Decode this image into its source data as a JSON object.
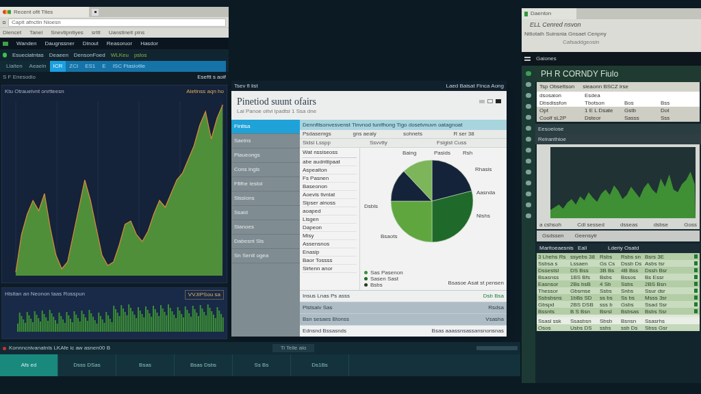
{
  "left_window": {
    "browser_tab": "Recent ofit Tites",
    "address": "Capit afnctin Nioesn",
    "bookmarks": [
      "Diencet",
      "Tanei",
      "Snevtipntiyes",
      "srtlt",
      "Uanstineit pins"
    ],
    "menu": [
      "Wanden",
      "Daugnssner",
      "Dinout",
      "Reasoruor",
      "Hasdor"
    ],
    "toolbar": [
      "Esueciatntas",
      "Deaeen",
      "DensonFoed",
      "WLKeu",
      "pslos"
    ],
    "tabs": [
      {
        "label": "Llaiten",
        "selected": false
      },
      {
        "label": "Aeaein",
        "selected": false
      },
      {
        "label": "ICR",
        "selected": true
      },
      {
        "label": "ZCI",
        "selected": false
      },
      {
        "label": "ES1",
        "selected": false
      },
      {
        "label": "E",
        "selected": false
      },
      {
        "label": "ISC Ftasiotiie",
        "selected": false
      }
    ],
    "section_label": "S F Enesodio",
    "side_note": "Eseftt s aoif",
    "price_panel": {
      "title": "Ktu Otraueivnt onrtteesn",
      "legend": "Aletinss aqn ho"
    },
    "volume_panel": {
      "title": "Hisitan an Neonon taas Rosspun",
      "badge": "VVJIPSou sa"
    }
  },
  "center_window": {
    "top_left": "Tsev fl iist",
    "top_right": "Laed Baisat Finca Aong",
    "title": "Pinetiod suunt ofairs",
    "subtitle": "Lai Panoe oitvi  ipadtsi 1 Ssa dne",
    "sidebar": [
      {
        "label": "Fintisa",
        "selected": true
      },
      {
        "label": "Saeins",
        "selected": false
      },
      {
        "label": "Piaueongs",
        "selected": false
      },
      {
        "label": "Cons ingis",
        "selected": false
      },
      {
        "label": "Ffifhe Iestol",
        "selected": false
      },
      {
        "label": "Sissions",
        "selected": false
      },
      {
        "label": "Ssaid",
        "selected": false
      },
      {
        "label": "Sianoes",
        "selected": false
      },
      {
        "label": "Dabesnt Sls",
        "selected": false
      },
      {
        "label": "Sn Senit ogea",
        "selected": false
      }
    ],
    "banner": "Dennfitsonvesvenst Tinvnod tunifhong Tigo dosetvnuvn oatagnoat",
    "header": [
      "Psdasemgs",
      "gns aealy",
      "sohnets",
      "R ser 38"
    ],
    "subheader": [
      "Sidsi Lsspp",
      "Ssvvtty",
      "Fsigist Cuss"
    ],
    "list_title": "Wat nssiseoss",
    "list": [
      "abe audntiipaat",
      "Aspeaiton",
      "Fs Pasnen",
      "Baseonon",
      "Aoevis tivnlat",
      "Sipser ainoss",
      "aoaped",
      "Lisgen",
      "Dapeon",
      "Misy",
      "Assensnos",
      "Enasip",
      "Baor Tossss",
      "Sirtenn anor"
    ],
    "pie_labels": [
      "Baing",
      "Pasids",
      "Rsh",
      "Rhasis",
      "Aasnda",
      "Nishs",
      "Dsbls",
      "Bsaots"
    ],
    "pie_legend": [
      "Sas Pasenon",
      "Sasen Sast",
      "Bsbs"
    ],
    "pie_footer": "Bsasoe Asat st pensen",
    "footer": [
      {
        "label": "Insus Lnas  Ps asss",
        "value": "Dsb Bsa"
      },
      {
        "label": "Pistsalv Sas",
        "value": "Rsdsa"
      },
      {
        "label": "Bsn sesaes Btonss",
        "value": "Vsasha"
      },
      {
        "label": "Ednsnd Bssasnds",
        "value": "Bsas aaassnsassansnonsnas"
      }
    ]
  },
  "right_window": {
    "browser_tab": "Daenton",
    "address": "ELL Cenred nsvon",
    "links": "Nitiotaih Suinsnia Gnsaet Cenpny",
    "url_hint": "Cafsaddgeosin",
    "toolbar": "Gaiones",
    "title": "PH R CORNDY Fiulo",
    "summary_label": "Tsp Obsettson",
    "summary_value": "sieaonn BSCZ irse",
    "summary_rows": [
      [
        "dsosaion",
        "Esdea",
        "",
        ""
      ],
      [
        "Dbsdissfon",
        "Tbotson",
        "Bos",
        "Bss"
      ],
      [
        "Opt",
        "1 E L Dsate",
        "Gstb",
        "Dot"
      ],
      [
        "Coolf sL2P",
        "Dsteor",
        "Sasss",
        "Sss"
      ]
    ],
    "section_1": "Eesoeiose",
    "section_2": "Reiranthioe",
    "axis_labels": [
      "a cshsoh",
      "Cdl sessed",
      "dsseas",
      "dsbse",
      "Goss"
    ],
    "filter_label": "Gsdssen",
    "filter_value": "Geensytr",
    "table_columns": [
      "Maritoeaesnis",
      "Eall",
      "Lderiy Osatd"
    ],
    "table_rows": [
      [
        "3 Lhehs Rs",
        "ssyebs 38",
        "Rsbs",
        "Rsbs sn",
        "Bsrs 3E"
      ],
      [
        "Ssbsa s",
        "Lssaen",
        "Gs Cs",
        "Dssb Ds",
        "Asbs tsr"
      ],
      [
        "Dssestsl",
        "DS Bss",
        "3B Bs",
        "4B Bss",
        "Dssh Bsr"
      ],
      [
        "Bsasnss",
        "1BS Bfs",
        "Bsbs",
        "Bssos",
        "Bs Essr"
      ],
      [
        "Easnsor",
        "2Bs bsB",
        "4 Sb",
        "Ssbs",
        "2BS Bsn"
      ],
      [
        "Thessor",
        "Gbsmse",
        "Ssbs",
        "Snbs",
        "Ssur dsr"
      ],
      [
        "Ssbsbsns",
        "1bBs SD",
        "ss bs",
        "Ss bs",
        "Msss 3sr"
      ],
      [
        "Gbspd",
        "2BS DSB",
        "sss b",
        "Gsbs",
        "Ssad Ssr"
      ],
      [
        "Bssnts",
        "B S Bsn",
        "Bsrsl",
        "Bsbsas",
        "Bsbs Ssr"
      ]
    ],
    "total_rows": [
      [
        "Ssasl ssk",
        "Ssasbsn",
        "Sbsb",
        "Bsnsn",
        "Ssasrhs"
      ],
      [
        "Osos",
        "Usbs DS",
        "ssbs",
        "ssb Ds",
        "Sbss Gsr"
      ]
    ]
  },
  "bottom_bar": {
    "status": "Konnncnivanatnls LKAfe ic aw asnen00 B",
    "center": "Ti Teile alo",
    "cells": [
      "Afs ed",
      "Dsss DSas",
      "Bsas",
      "Bsas Dsbs",
      "Ss Bs",
      "Ds1Bs"
    ]
  }
}
